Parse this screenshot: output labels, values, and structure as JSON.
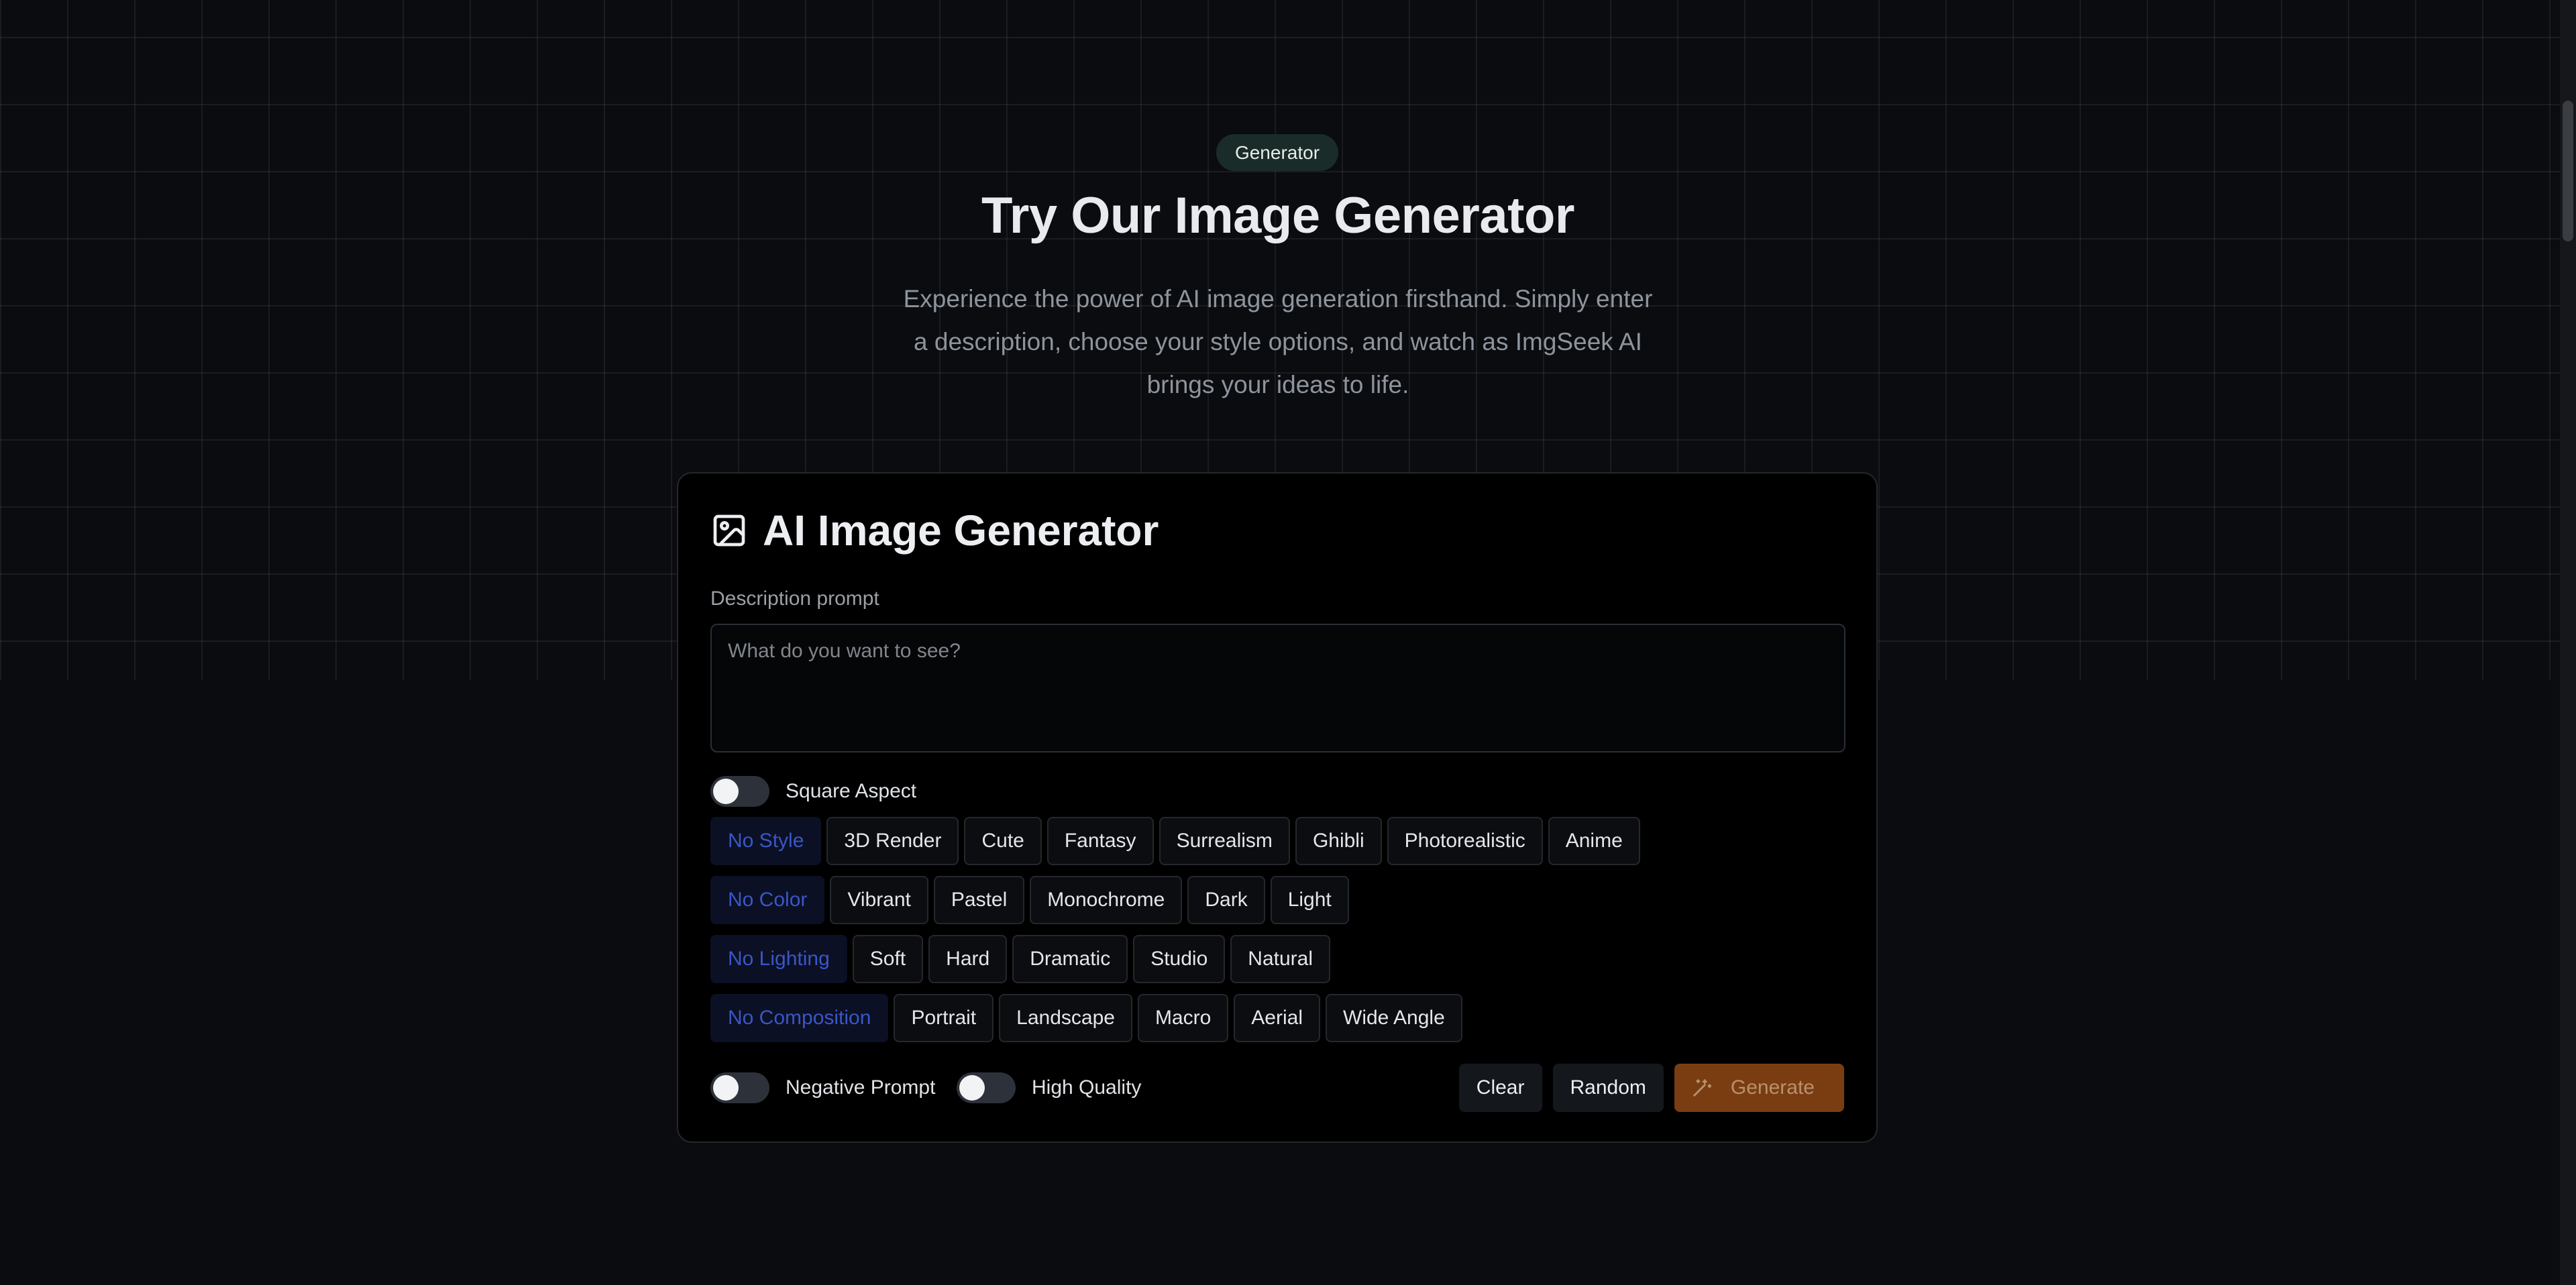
{
  "hero": {
    "badge": "Generator",
    "title": "Try Our Image Generator",
    "description": "Experience the power of AI image generation firsthand. Simply enter a description, choose your style options, and watch as ImgSeek AI brings your ideas to life."
  },
  "card": {
    "icon": "image-icon",
    "title": "AI Image Generator",
    "prompt_label": "Description prompt",
    "prompt_placeholder": "What do you want to see?",
    "prompt_value": "",
    "square_aspect_label": "Square Aspect",
    "style_chips": [
      "No Style",
      "3D Render",
      "Cute",
      "Fantasy",
      "Surrealism",
      "Ghibli",
      "Photorealistic",
      "Anime"
    ],
    "color_chips": [
      "No Color",
      "Vibrant",
      "Pastel",
      "Monochrome",
      "Dark",
      "Light"
    ],
    "lighting_chips": [
      "No Lighting",
      "Soft",
      "Hard",
      "Dramatic",
      "Studio",
      "Natural"
    ],
    "composition_chips": [
      "No Composition",
      "Portrait",
      "Landscape",
      "Macro",
      "Aerial",
      "Wide Angle"
    ],
    "negative_prompt_label": "Negative Prompt",
    "high_quality_label": "High Quality",
    "clear_label": "Clear",
    "random_label": "Random",
    "generate_label": "Generate",
    "generate_icon": "magic-wand-icon"
  },
  "colors": {
    "background": "#0a0c10",
    "card": "#000000",
    "active_chip_text": "#3a56c8",
    "generate_button": "#7a3d12"
  }
}
